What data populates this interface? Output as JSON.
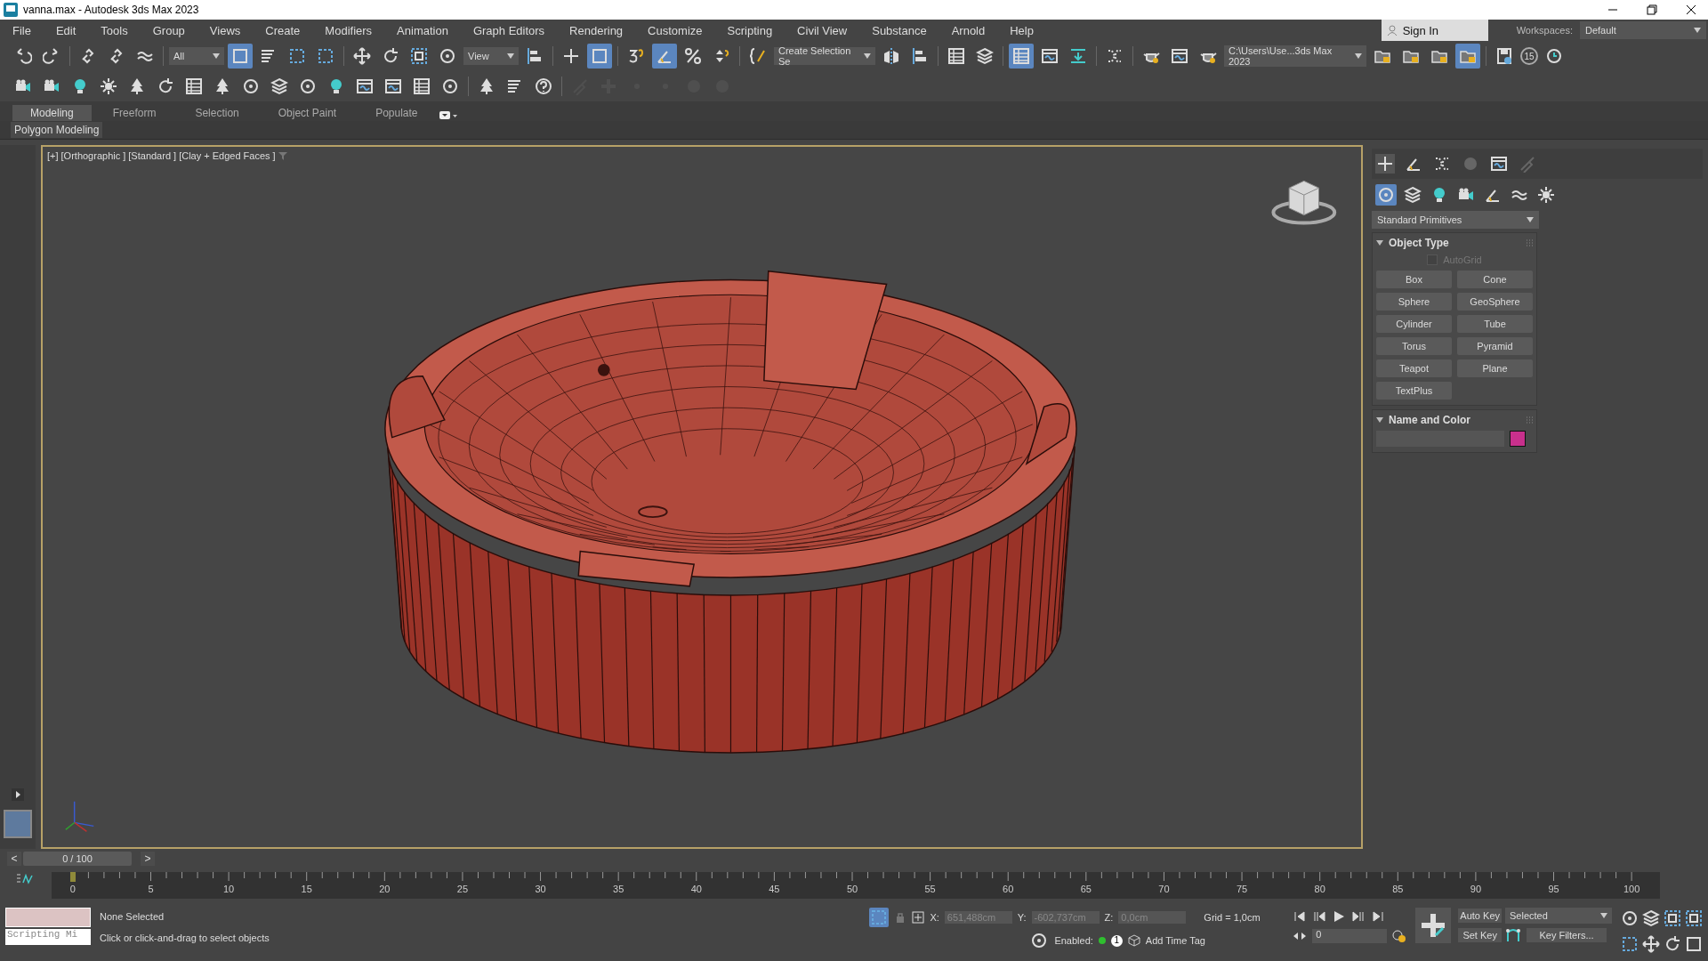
{
  "window": {
    "title": "vanna.max - Autodesk 3ds Max 2023"
  },
  "menu": [
    "File",
    "Edit",
    "Tools",
    "Group",
    "Views",
    "Create",
    "Modifiers",
    "Animation",
    "Graph Editors",
    "Rendering",
    "Customize",
    "Scripting",
    "Civil View",
    "Substance",
    "Arnold",
    "Help"
  ],
  "account": {
    "sign_in": "Sign In",
    "workspaces_label": "Workspaces:",
    "workspace": "Default"
  },
  "main_toolbar": {
    "selection_filter": "All",
    "reference_coordinate": "View",
    "named_selection": "Create Selection Se",
    "project_path": "C:\\Users\\Use...3ds Max 2023",
    "backup_badge": "15",
    "buttons": [
      {
        "selected": false
      },
      {
        "selected": false
      },
      {
        "selected": false
      },
      {
        "selected": false
      },
      {
        "selected": false
      },
      {
        "selected": true
      },
      {
        "selected": false
      },
      {
        "selected": false
      },
      {
        "selected": false
      },
      {
        "selected": false
      },
      {
        "selected": false
      },
      {
        "selected": false
      },
      {
        "selected": false
      },
      {
        "selected": false
      },
      {
        "selected": false
      },
      {
        "selected": true
      },
      {
        "selected": false
      },
      {
        "selected": true
      },
      {
        "selected": false
      },
      {
        "selected": false
      },
      {
        "selected": false
      },
      {
        "selected": false
      },
      {
        "selected": false
      },
      {
        "selected": false
      },
      {
        "selected": false
      },
      {
        "selected": true
      },
      {
        "selected": false
      },
      {
        "selected": false
      },
      {
        "selected": false
      },
      {
        "selected": false
      },
      {
        "selected": false
      },
      {
        "selected": false
      },
      {
        "selected": false
      },
      {
        "selected": false
      },
      {
        "selected": false
      },
      {
        "selected": true
      }
    ]
  },
  "secondary_toolbar": [
    {
      "disabled": false
    },
    {
      "disabled": false
    },
    {
      "disabled": false
    },
    {
      "disabled": false
    },
    {
      "disabled": false
    },
    {
      "disabled": false
    },
    {
      "disabled": false
    },
    {
      "disabled": false
    },
    {
      "disabled": false
    },
    {
      "disabled": false
    },
    {
      "disabled": false
    },
    {
      "disabled": false
    },
    {
      "disabled": false
    },
    {
      "disabled": false
    },
    {
      "disabled": false
    },
    {
      "disabled": false
    },
    {
      "disabled": false
    },
    {
      "disabled": false
    },
    {
      "disabled": false
    },
    {
      "disabled": true
    },
    {
      "disabled": true
    },
    {
      "disabled": true
    },
    {
      "disabled": true
    },
    {
      "disabled": true
    },
    {
      "disabled": true
    }
  ],
  "ribbon": {
    "tabs": [
      {
        "label": "Modeling",
        "selected": true
      },
      {
        "label": "Freeform",
        "selected": false
      },
      {
        "label": "Selection",
        "selected": false
      },
      {
        "label": "Object Paint",
        "selected": false
      },
      {
        "label": "Populate",
        "selected": false
      }
    ],
    "panel": "Polygon Modeling"
  },
  "viewport": {
    "labels": [
      "[+]",
      "[Orthographic ]",
      "[Standard ]",
      "[Clay + Edged Faces ]"
    ]
  },
  "command_panel": {
    "tabs": [
      {
        "selected": true
      },
      {
        "selected": false
      },
      {
        "selected": false
      },
      {
        "selected": false
      },
      {
        "selected": false
      },
      {
        "selected": false
      }
    ],
    "categories": [
      {
        "selected": true
      },
      {
        "selected": false
      },
      {
        "selected": false
      },
      {
        "selected": false
      },
      {
        "selected": false
      },
      {
        "selected": false
      },
      {
        "selected": false
      }
    ],
    "dropdown": "Standard Primitives",
    "object_type": {
      "title": "Object Type",
      "expanded": true,
      "autogrid": {
        "label": "AutoGrid",
        "checked": false,
        "disabled": true
      },
      "buttons": [
        "Box",
        "Cone",
        "Sphere",
        "GeoSphere",
        "Cylinder",
        "Tube",
        "Torus",
        "Pyramid",
        "Teapot",
        "Plane",
        "TextPlus"
      ]
    },
    "name_and_color": {
      "title": "Name and Color",
      "expanded": true,
      "color": "#c8308c"
    }
  },
  "time_slider": {
    "prev": "<",
    "position": "0 / 100",
    "next": ">",
    "level": 0
  },
  "track_bar": {
    "labels": [
      "0",
      "5",
      "10",
      "15",
      "20",
      "25",
      "30",
      "35",
      "40",
      "45",
      "50",
      "55",
      "60",
      "65",
      "70",
      "75",
      "80",
      "85",
      "90",
      "95",
      "100"
    ]
  },
  "status_bar": {
    "listener": "Scripting Mi",
    "selection": "None Selected",
    "prompt": "Click or click-and-drag to select objects",
    "x_label": "X:",
    "x": "651,488cm",
    "y_label": "Y:",
    "y": "-602,737cm",
    "z_label": "Z:",
    "z": "0,0cm",
    "grid": "Grid = 1,0cm",
    "enabled_label": "Enabled:",
    "enabled": true,
    "time_tag_count": "1",
    "add_time_tag": "Add Time Tag",
    "auto_key": "Auto Key",
    "set_key": "Set Key",
    "key_mode": "Selected",
    "key_filters": "Key Filters...",
    "frame": "0"
  }
}
